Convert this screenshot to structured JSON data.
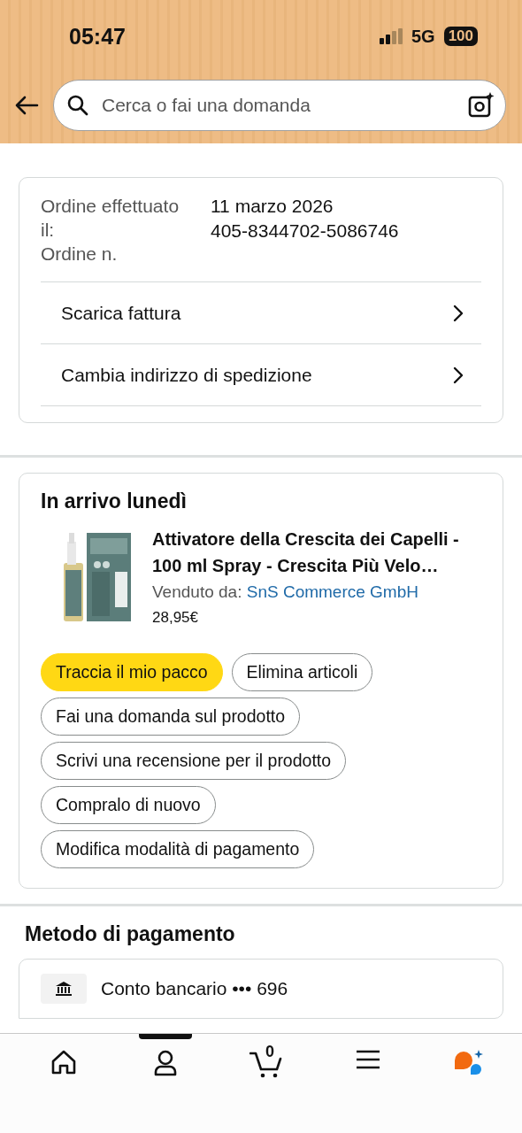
{
  "status_bar": {
    "time": "05:47",
    "network": "5G",
    "battery": "100"
  },
  "search": {
    "placeholder": "Cerca o fai una domanda"
  },
  "order_info": {
    "labels": [
      "Ordine effettuato il:",
      "Ordine n."
    ],
    "values": [
      "11 marzo 2026",
      "405-8344702-5086746"
    ],
    "links": [
      {
        "label": "Scarica fattura"
      },
      {
        "label": "Cambia indirizzo di spedizione"
      }
    ]
  },
  "shipment": {
    "title": "In arrivo lunedì",
    "product": {
      "kind": "picture",
      "title": "Attivatore della Crescita dei Capelli - 100 ml Spray - Crescita Più Velo…",
      "seller_label": "Venduto da:",
      "seller": "SnS Commerce GmbH",
      "price": "28,95€"
    },
    "actions": [
      {
        "label": "Traccia il mio pacco",
        "kind": "primary"
      },
      {
        "label": "Elimina articoli",
        "kind": "secondary"
      },
      {
        "label": "Fai una domanda sul prodotto",
        "kind": "secondary"
      },
      {
        "label": "Scrivi una recensione per il prodotto",
        "kind": "secondary"
      },
      {
        "label": "Compralo di nuovo",
        "kind": "secondary"
      },
      {
        "label": "Modifica modalità di pagamento",
        "kind": "secondary"
      }
    ]
  },
  "payment": {
    "title": "Metodo di pagamento",
    "method": "Conto bancario ••• 696"
  },
  "bottom_nav": [
    {
      "kind": "home",
      "selected": false
    },
    {
      "kind": "account",
      "selected": true
    },
    {
      "kind": "cart",
      "badge": "0",
      "selected": false
    },
    {
      "kind": "menu",
      "selected": false
    },
    {
      "kind": "assistant",
      "selected": false
    }
  ]
}
